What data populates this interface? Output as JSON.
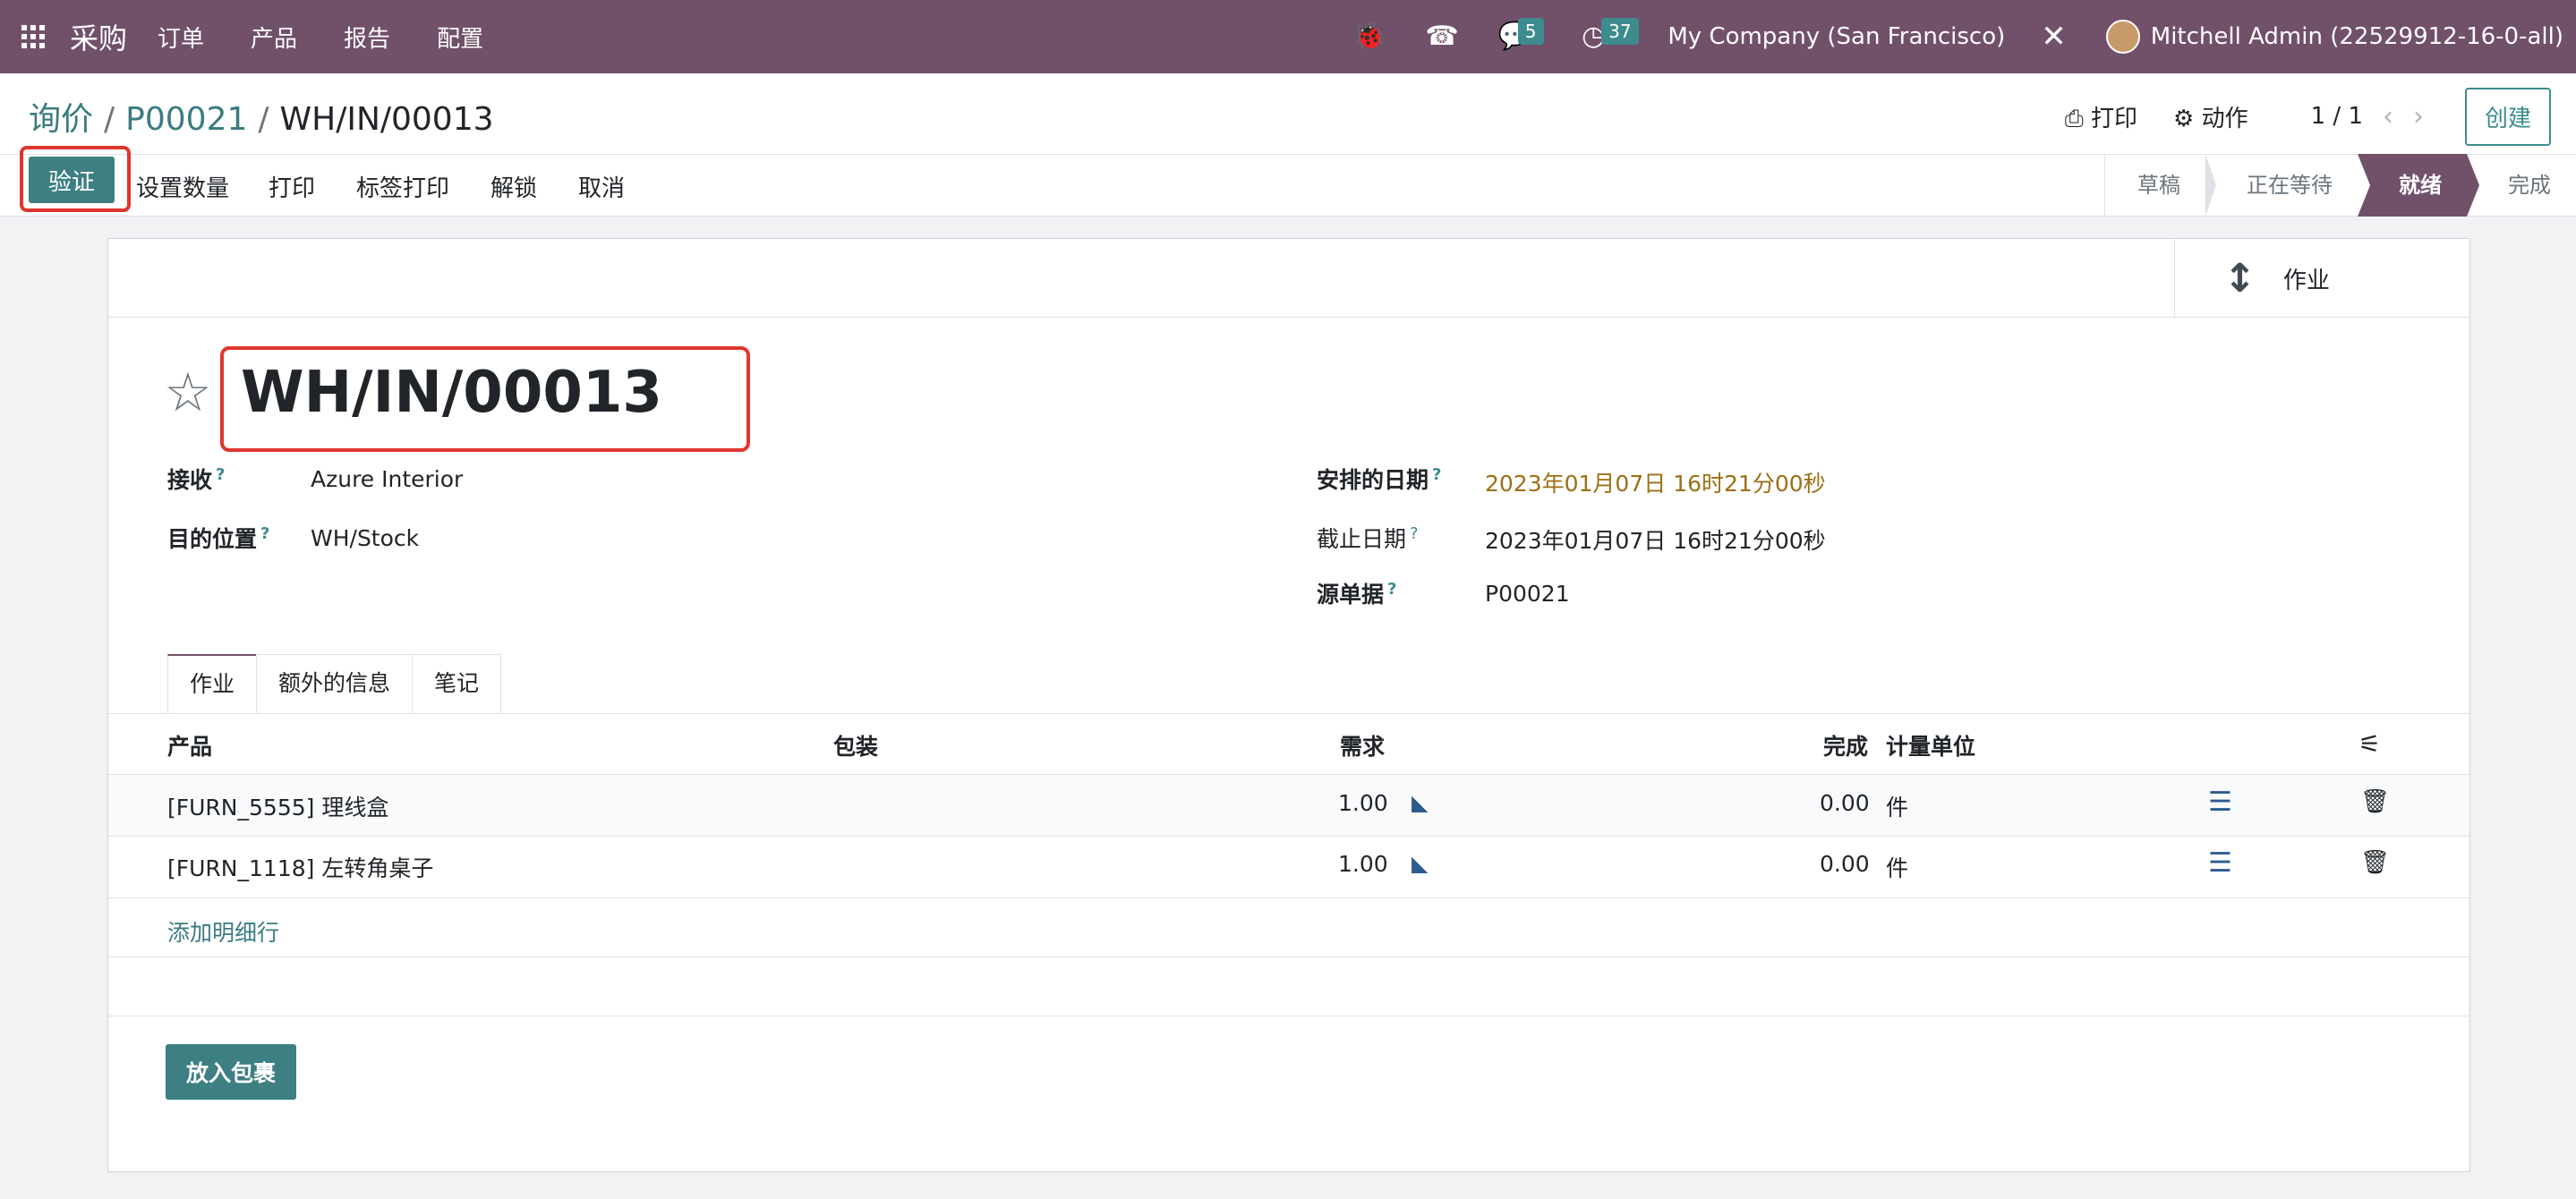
{
  "navbar": {
    "brand": "采购",
    "menu": [
      "订单",
      "产品",
      "报告",
      "配置"
    ],
    "messages_count": "5",
    "activities_count": "37",
    "company": "My Company (San Francisco)",
    "user": "Mitchell Admin (22529912-16-0-all)",
    "bg_color": "#71506a"
  },
  "breadcrumb": {
    "items": [
      "询价",
      "P00021",
      "WH/IN/00013"
    ],
    "separator": "/"
  },
  "control": {
    "print_label": "打印",
    "action_label": "动作",
    "pager": "1 / 1",
    "create_label": "创建"
  },
  "actions": {
    "validate": "验证",
    "set_quantity": "设置数量",
    "print": "打印",
    "label_print": "标签打印",
    "unlock": "解锁",
    "cancel": "取消"
  },
  "statusbar": {
    "stages": [
      "草稿",
      "正在等待",
      "就绪",
      "完成"
    ],
    "active": "就绪"
  },
  "smart_button": {
    "label": "作业"
  },
  "record": {
    "title": "WH/IN/00013",
    "receive_label": "接收",
    "receive_value": "Azure Interior",
    "dest_label": "目的位置",
    "dest_value": "WH/Stock",
    "scheduled_label": "安排的日期",
    "scheduled_value": "2023年01月07日 16时21分00秒",
    "deadline_label": "截止日期",
    "deadline_value": "2023年01月07日 16时21分00秒",
    "source_label": "源单据",
    "source_value": "P00021"
  },
  "tabs": [
    "作业",
    "额外的信息",
    "笔记"
  ],
  "table": {
    "headers": {
      "product": "产品",
      "packaging": "包装",
      "demand": "需求",
      "done": "完成",
      "uom": "计量单位"
    },
    "rows": [
      {
        "product": "[FURN_5555] 理线盒",
        "demand": "1.00",
        "done": "0.00",
        "uom": "件"
      },
      {
        "product": "[FURN_1118] 左转角桌子",
        "demand": "1.00",
        "done": "0.00",
        "uom": "件"
      }
    ],
    "add_line": "添加明细行"
  },
  "put_in_pack": "放入包裹"
}
